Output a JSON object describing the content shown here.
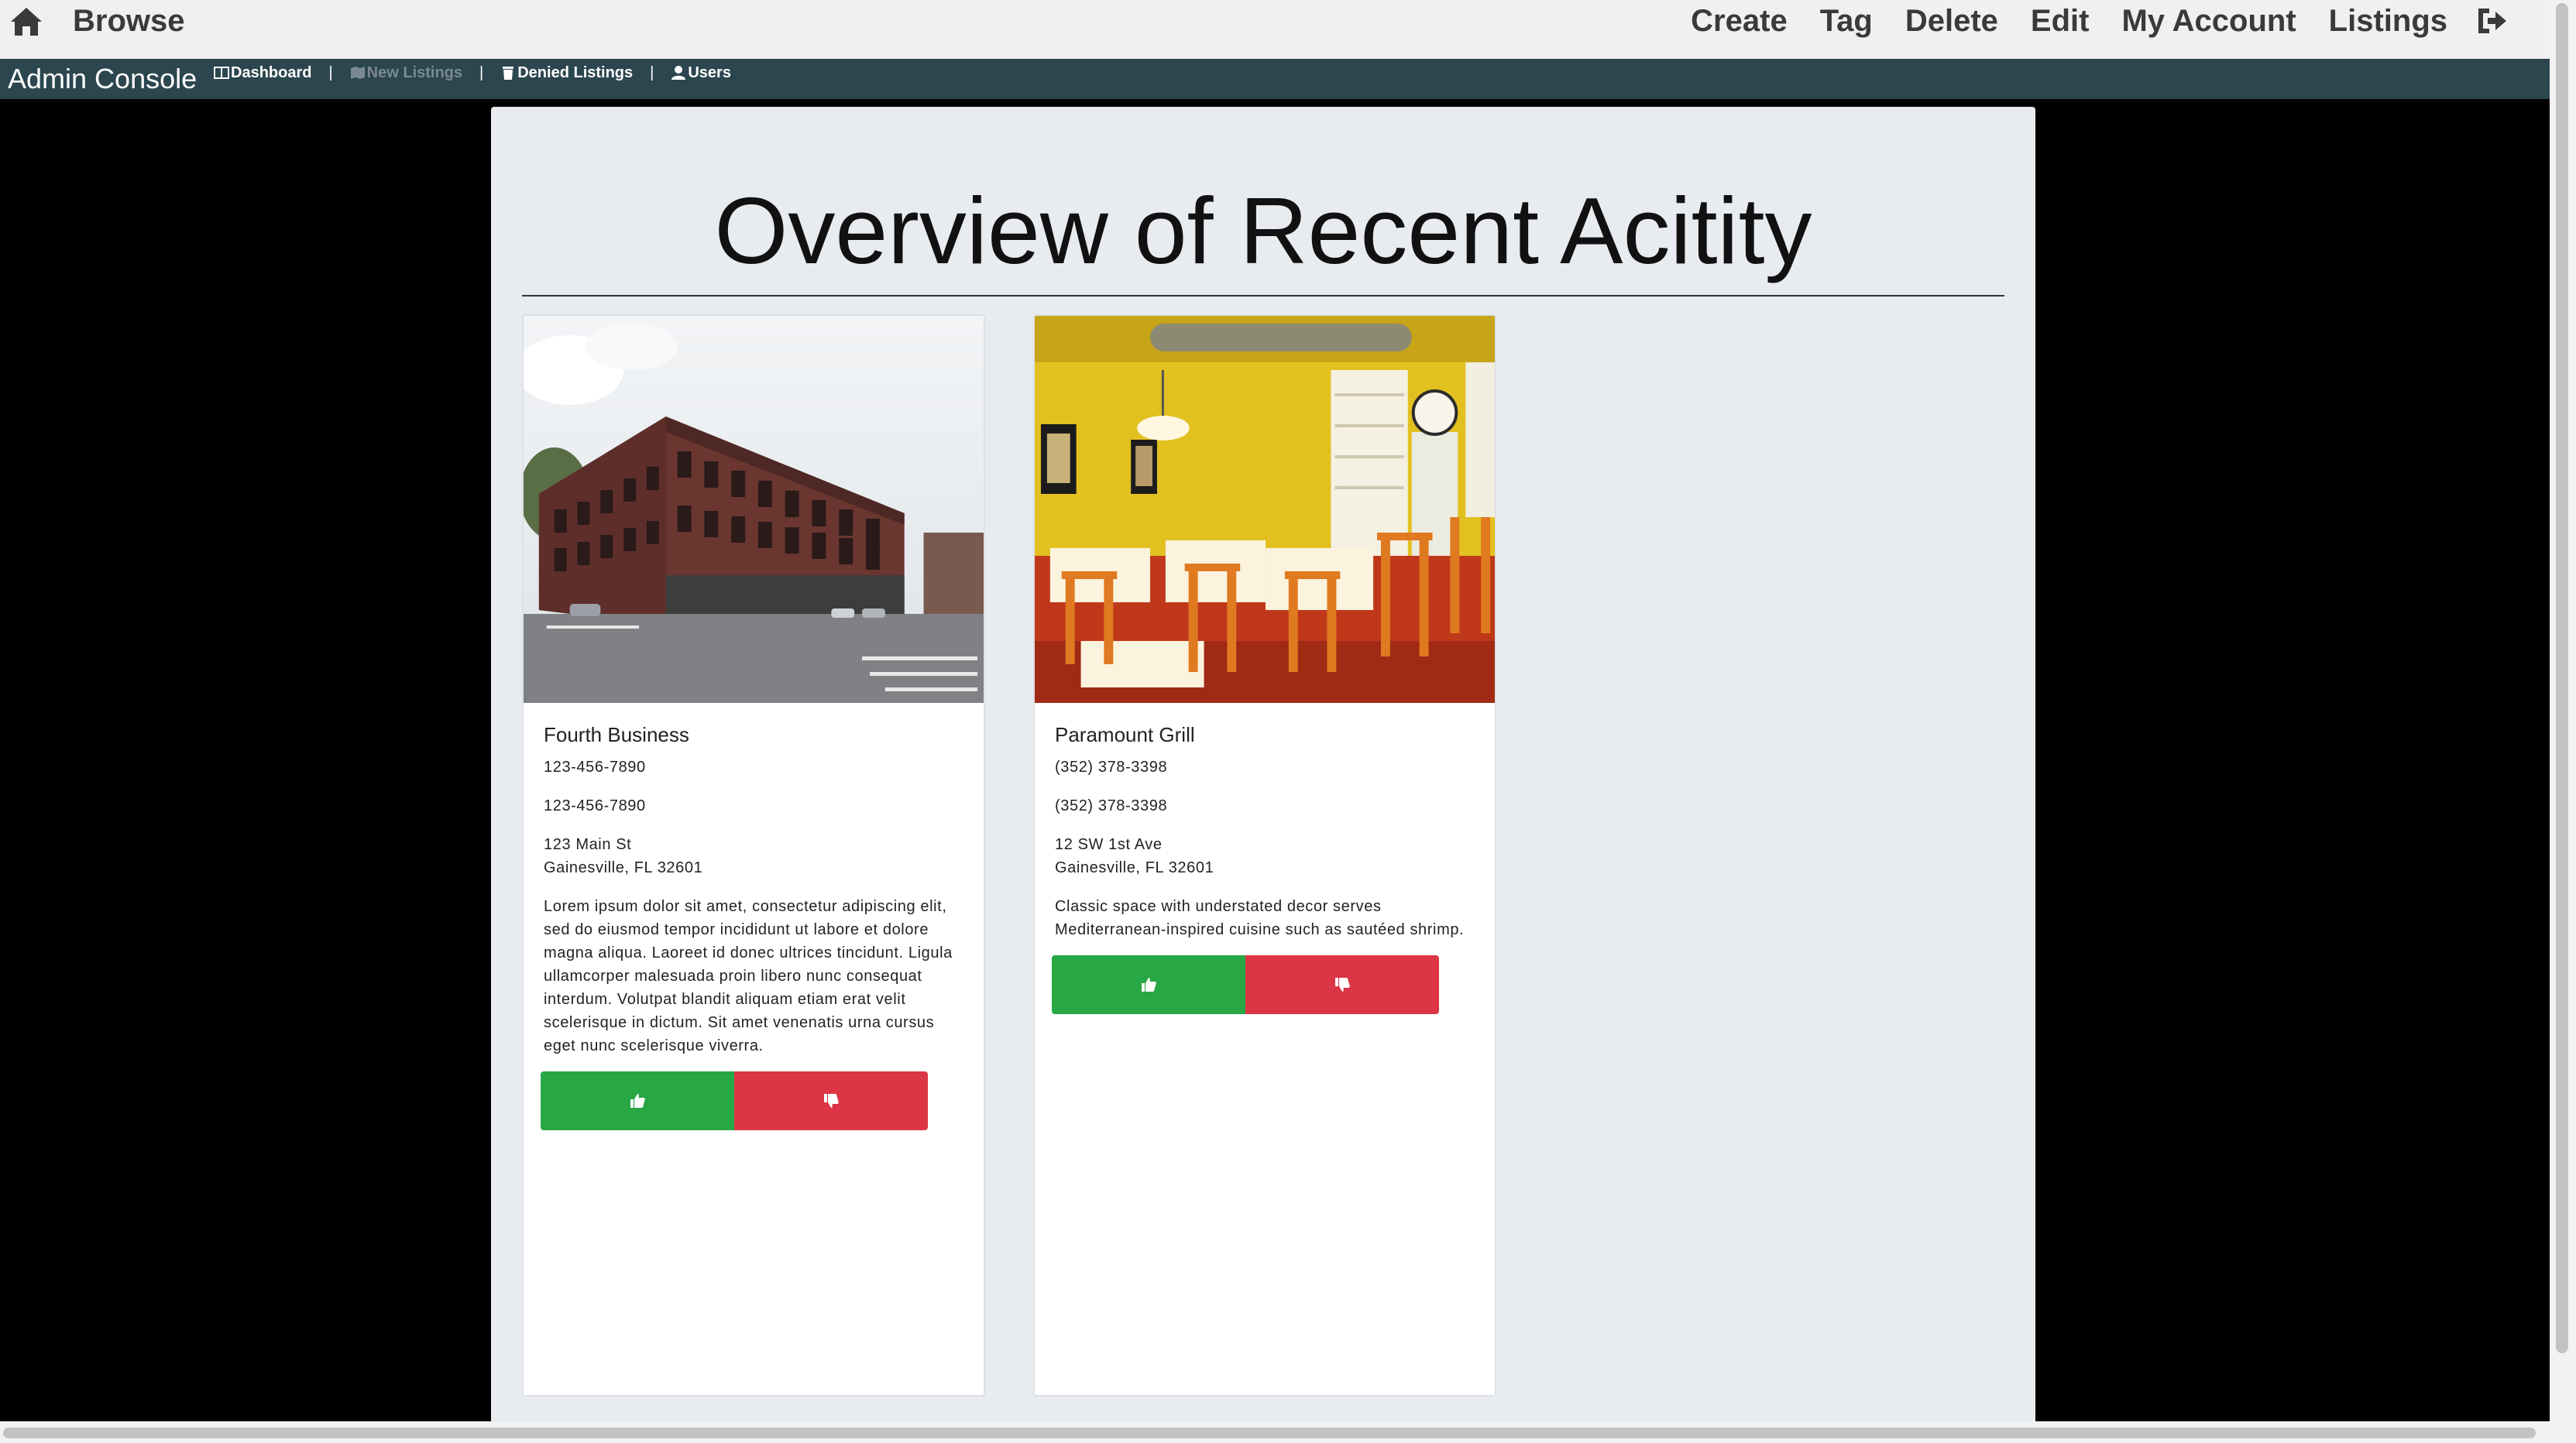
{
  "topnav": {
    "brand_label": "Browse",
    "items": [
      "Create",
      "Tag",
      "Delete",
      "Edit",
      "My Account",
      "Listings"
    ]
  },
  "adminbar": {
    "title": "Admin Console",
    "links": [
      {
        "label": "Dashboard",
        "icon": "columns-icon",
        "disabled": false
      },
      {
        "label": "New Listings",
        "icon": "map-icon",
        "disabled": true
      },
      {
        "label": "Denied Listings",
        "icon": "trash-icon",
        "disabled": false
      },
      {
        "label": "Users",
        "icon": "user-icon",
        "disabled": false
      }
    ],
    "separator": "|"
  },
  "main": {
    "title": "Overview of Recent Acitity",
    "cards": [
      {
        "name": "Fourth Business",
        "phone1": "123-456-7890",
        "phone2": "123-456-7890",
        "address_line1": "123 Main St",
        "address_line2": "Gainesville, FL 32601",
        "description": "Lorem ipsum dolor sit amet, consectetur adipiscing elit, sed do eiusmod tempor incididunt ut labore et dolore magna aliqua. Laoreet id donec ultrices tincidunt. Ligula ullamcorper malesuada proin libero nunc consequat interdum. Volutpat blandit aliquam etiam erat velit scelerisque in dictum. Sit amet venenatis urna cursus eget nunc scelerisque viverra.",
        "image": "brick-building-photo"
      },
      {
        "name": "Paramount Grill",
        "phone1": "(352) 378-3398",
        "phone2": "(352) 378-3398",
        "address_line1": "12 SW 1st Ave",
        "address_line2": "Gainesville, FL 32601",
        "description": "Classic space with understated decor serves Mediterranean-inspired cuisine such as sautéed shrimp.",
        "image": "restaurant-interior-photo"
      }
    ]
  },
  "colors": {
    "approve": "#28a745",
    "deny": "#dc3545",
    "adminbar": "#2c4650",
    "panel": "#e8ebef"
  }
}
